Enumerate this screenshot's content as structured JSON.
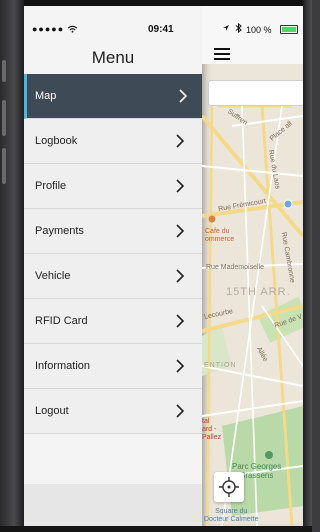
{
  "status_bar": {
    "signal": "●●●●● ",
    "wifi_icon": "wifi-icon",
    "time": "09:41",
    "location_icon": "location-arrow-icon",
    "bluetooth_icon": "bluetooth-icon",
    "battery_pct": "100 %",
    "battery_level": 1.0
  },
  "menu": {
    "title": "Menu",
    "items": [
      {
        "label": "Map",
        "active": true
      },
      {
        "label": "Logbook",
        "active": false
      },
      {
        "label": "Profile",
        "active": false
      },
      {
        "label": "Payments",
        "active": false
      },
      {
        "label": "Vehicle",
        "active": false
      },
      {
        "label": "RFID Card",
        "active": false
      },
      {
        "label": "Information",
        "active": false
      },
      {
        "label": "Logout",
        "active": false
      }
    ]
  },
  "map": {
    "streets": {
      "suffren": "Suffren",
      "place_alle": "Place all",
      "rue_laos": "Rue du Laos",
      "rue_fremicourt": "Rue Frémicourt",
      "rue_cambronne": "Rue Cambronne",
      "rue_mademoiselle": "Rue Mademoiselle",
      "rue_lecourbe": "Lecourbe",
      "rue_de_v": "Rue de V",
      "allee": "Allée",
      "ention": "ENTION"
    },
    "area": "15TH ARR.",
    "pois": {
      "cafe": "Cafe du\nommerce",
      "hospital": "tal\nard -\nPallez"
    },
    "parks": {
      "parc_georges": "Parc Georges\nBrassens",
      "square": "Square du\nDocteur Calmette"
    },
    "colors": {
      "active_accent": "#4fb3df",
      "active_bg": "#3f4a57",
      "park_green": "#b9d9a8",
      "road_yellow": "#f5d98a"
    }
  }
}
